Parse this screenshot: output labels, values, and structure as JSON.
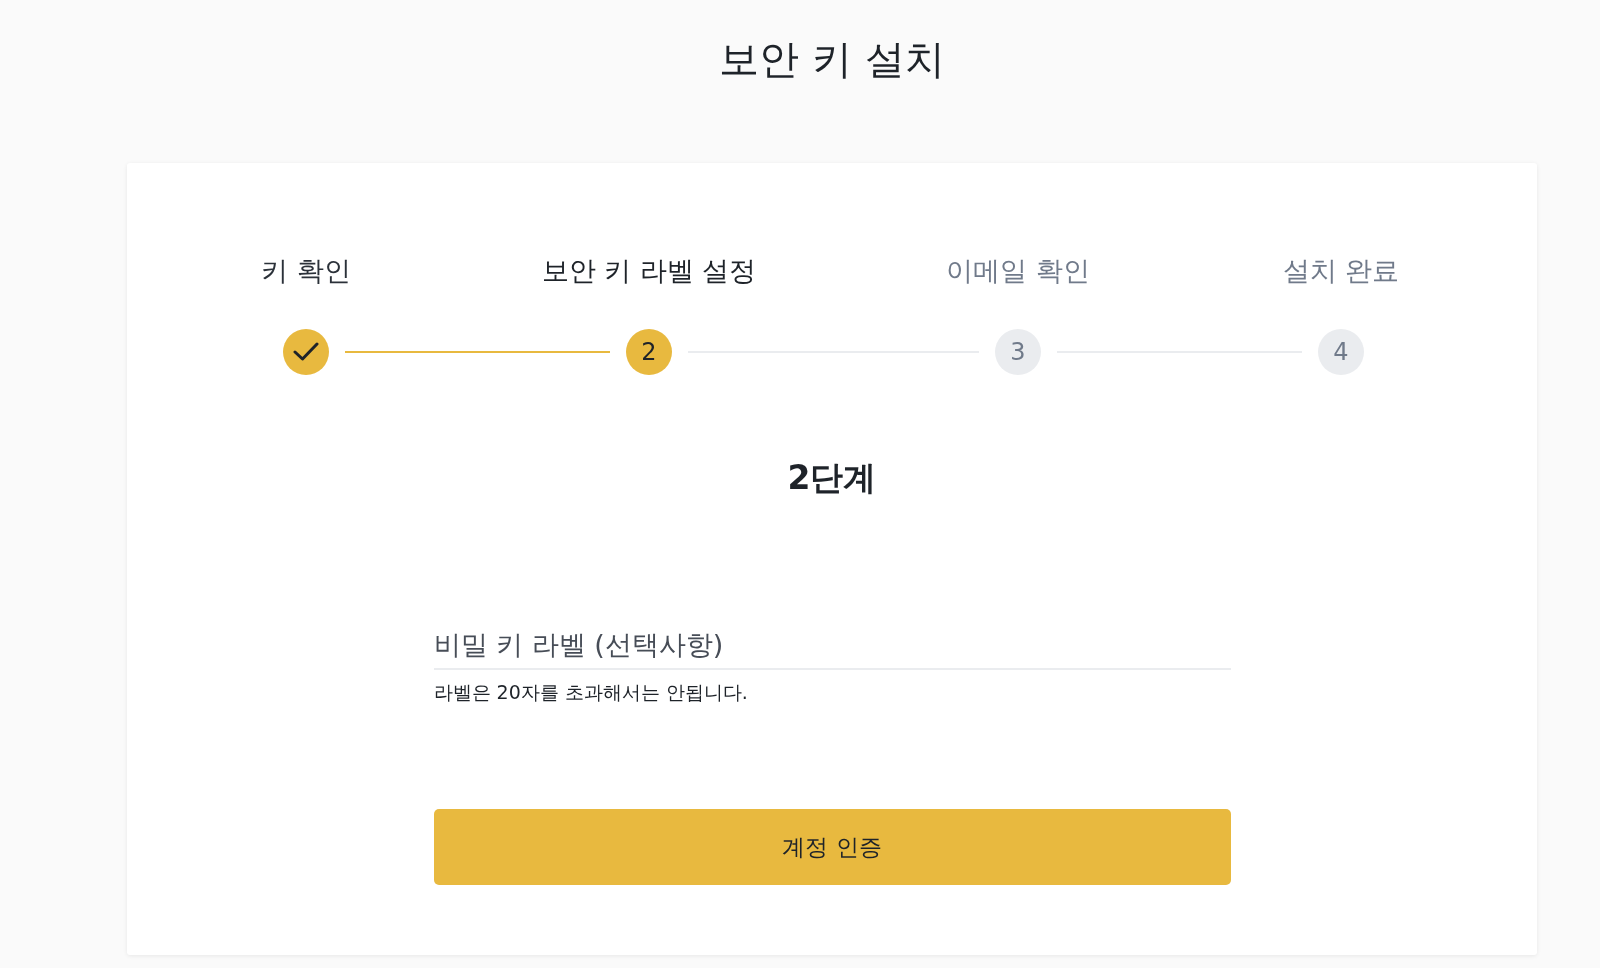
{
  "page_title": "보안 키 설치",
  "steps": [
    {
      "label": "키 확인",
      "completed": true,
      "selected": false
    },
    {
      "label": "보안 키 라벨 설정",
      "number": "2",
      "completed": false,
      "selected": true
    },
    {
      "label": "이메일 확인",
      "number": "3",
      "completed": false,
      "selected": false
    },
    {
      "label": "설치 완료",
      "number": "4",
      "completed": false,
      "selected": false
    }
  ],
  "step_title": "2단계",
  "label_field": {
    "placeholder": "비밀 키 라벨 (선택사항)",
    "hint": "라벨은 20자를 초과해서는 안됩니다."
  },
  "submit_button": "계정 인증"
}
